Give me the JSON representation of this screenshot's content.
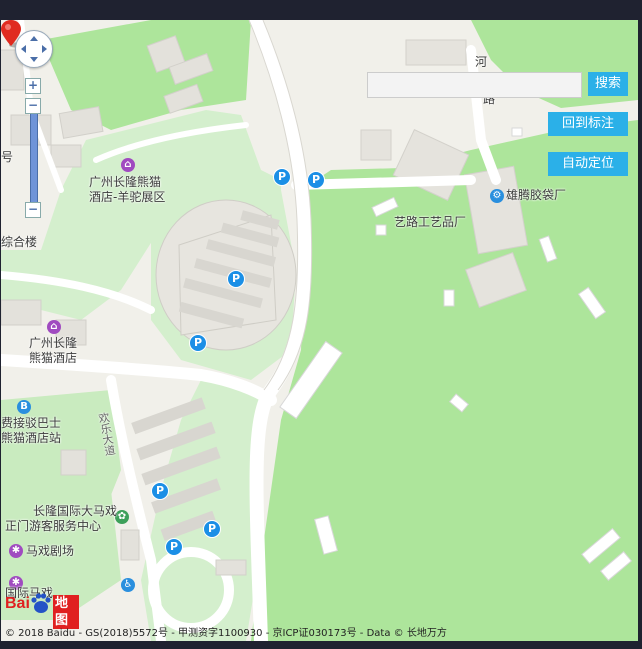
{
  "controls": {
    "search_placeholder": "",
    "search_label": "搜索",
    "back_to_marker_label": "回到标注",
    "auto_locate_label": "自动定位",
    "zoom_in_symbol": "+",
    "zoom_out_symbol": "−"
  },
  "map_labels": {
    "road_he": "河",
    "road_lu": "路",
    "hao": "号",
    "building_complex": "综合楼",
    "exhibit_alpaca": "广州长隆熊猫\n酒店-羊驼展区",
    "exhibit_alpaca_line1": "广州长隆熊猫",
    "exhibit_alpaca_line2": "酒店-羊驼展区",
    "hotel_line1": "广州长隆",
    "hotel_line2": "熊猫酒店",
    "shuttle_line1": "费接驳巴士",
    "shuttle_line2": "熊猫酒店站",
    "road_huanle": "欢乐大道",
    "circus_line1": "长隆国际大马戏",
    "circus_line2": "正门游客服务中心",
    "circus_theatre": "马戏剧场",
    "circus_intl": "国际马戏",
    "crafts_factory": "艺路工艺品厂",
    "bag_factory": "雄腾胶袋厂",
    "parking_symbol": "P"
  },
  "branding": {
    "bai": "Bai",
    "ditu": "地图",
    "copyright": "© 2018 Baidu - GS(2018)5572号 - 甲测资字1100930 - 京ICP证030173号 - Data © 长地万方"
  },
  "colors": {
    "map_background": "#f2f1ec",
    "green_area": "#aee79c",
    "light_green": "#d3efcc",
    "road": "#ffffff",
    "building": "#e4e2dc",
    "button_blue": "#2bb0e8",
    "parking_blue": "#1b8fe6",
    "marker_red": "#e02b20"
  },
  "icons": [
    "navigation-pan-icon",
    "zoom-in-icon",
    "zoom-out-icon",
    "parking-icon",
    "hotel-icon",
    "bus-icon",
    "factory-icon",
    "circus-icon",
    "map-marker-icon",
    "baidu-paw-icon"
  ]
}
